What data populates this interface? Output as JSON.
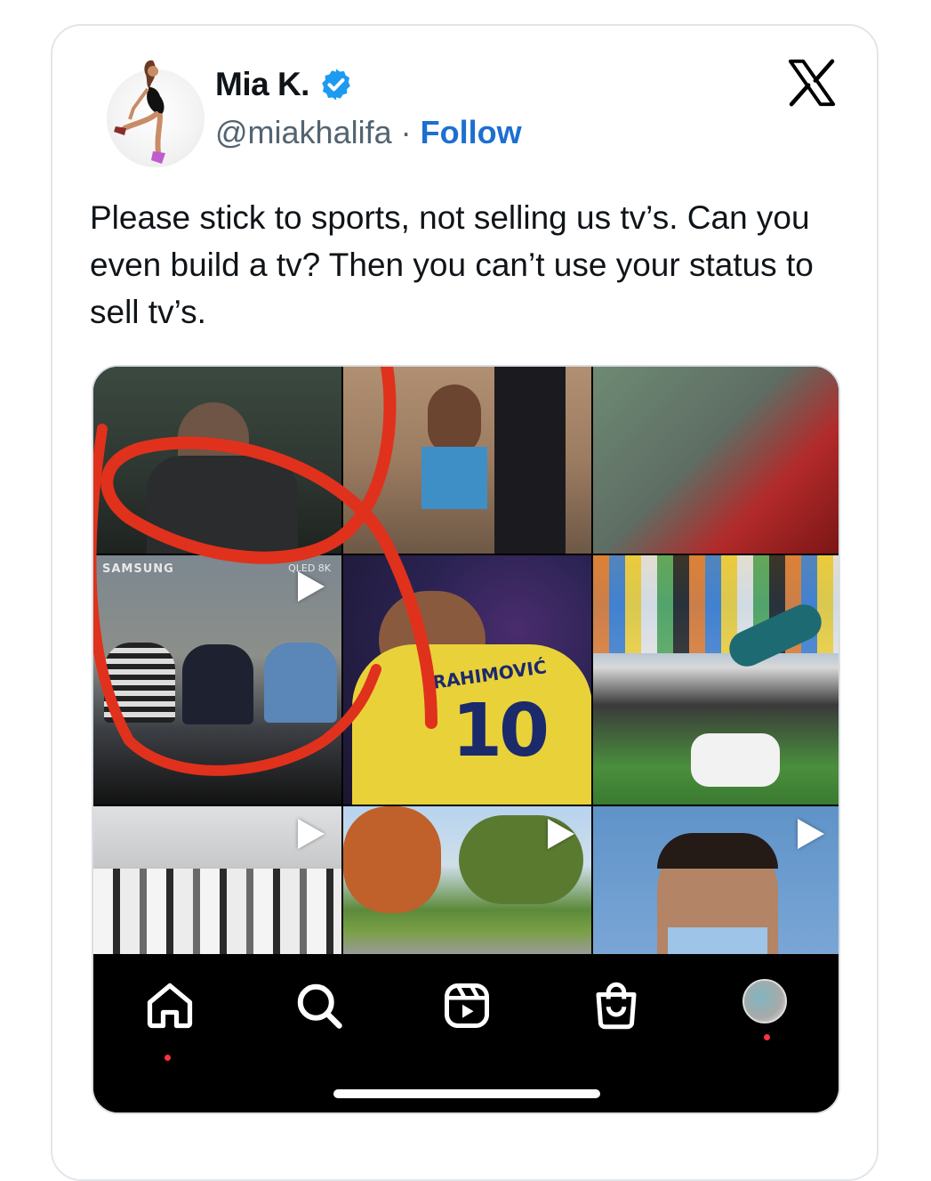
{
  "tweet": {
    "author_name": "Mia K.",
    "handle": "@miakhalifa",
    "separator": "·",
    "follow_label": "Follow",
    "text": "Please stick to sports, not selling us tv’s. Can you even build a tv? Then you can’t use your status to sell tv’s.",
    "verified_icon": "verified-badge-icon",
    "platform_icon": "x-logo-icon"
  },
  "media": {
    "grid_texts": {
      "samsung": "SAMSUNG",
      "qled": "QLED 8K",
      "jersey_name": "RAHIMOVIĆ",
      "jersey_number": "10"
    },
    "nav": {
      "items": [
        "home-icon",
        "search-icon",
        "reels-icon",
        "shop-icon",
        "profile-avatar"
      ]
    }
  },
  "colors": {
    "follow_blue": "#1d6fd0",
    "verified_blue": "#1d9bf0",
    "handle_gray": "#536471",
    "annotation_red": "#e0311c",
    "notification_red": "#ff3040"
  }
}
